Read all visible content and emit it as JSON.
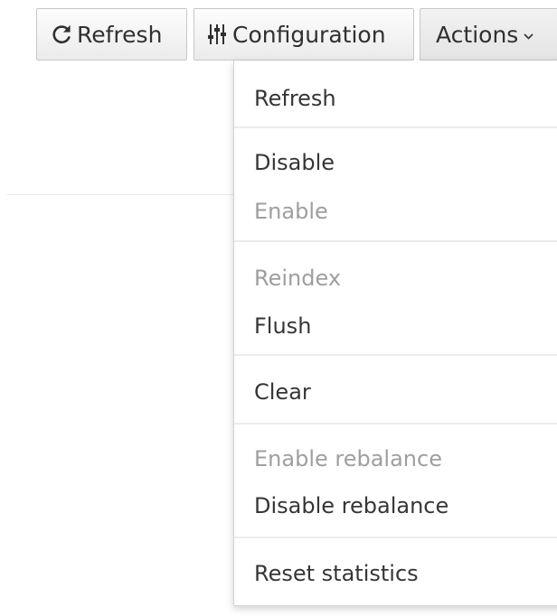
{
  "toolbar": {
    "refresh_label": "Refresh",
    "refresh_icon": "refresh-icon",
    "configuration_label": "Configuration",
    "configuration_icon": "sliders-icon",
    "actions_label": "Actions",
    "actions_icon": "chevron-down-icon"
  },
  "actions_menu": {
    "items": [
      {
        "label": "Refresh",
        "enabled": true
      },
      {
        "label": "Disable",
        "enabled": true
      },
      {
        "label": "Enable",
        "enabled": false
      },
      {
        "label": "Reindex",
        "enabled": false
      },
      {
        "label": "Flush",
        "enabled": true
      },
      {
        "label": "Clear",
        "enabled": true
      },
      {
        "label": "Enable rebalance",
        "enabled": false
      },
      {
        "label": "Disable rebalance",
        "enabled": true
      },
      {
        "label": "Reset statistics",
        "enabled": true
      }
    ]
  },
  "colors": {
    "text": "#363636",
    "disabled_text": "#9f9f9f",
    "button_border": "#c8c8c8",
    "menu_separator": "#ececec"
  }
}
